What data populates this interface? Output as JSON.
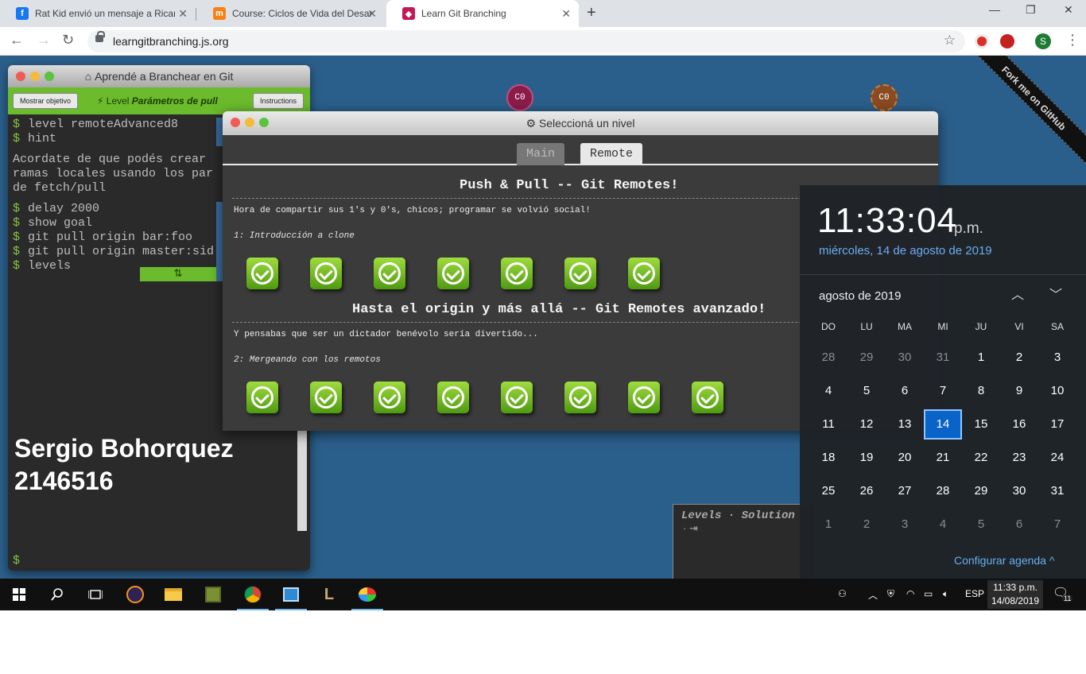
{
  "browser": {
    "tabs": [
      {
        "title": "Rat Kid envió un mensaje a Ricar",
        "fav": "f",
        "fav_color": "#1877f2",
        "close": "✕"
      },
      {
        "title": "Course: Ciclos de Vida del Desarr",
        "fav": "m",
        "fav_color": "#f98012",
        "close": "✕"
      },
      {
        "title": "Learn Git Branching",
        "fav": "◆",
        "fav_color": "#c2185b",
        "close": "✕"
      }
    ],
    "new_tab": "+",
    "window": {
      "minimize": "—",
      "maximize": "❐",
      "close": "✕"
    },
    "nav": {
      "back": "←",
      "forward": "→",
      "reload": "↻"
    },
    "url": "learngitbranching.js.org",
    "star": "☆",
    "profile_initial": "S",
    "menu": "⋮"
  },
  "page": {
    "nodes": [
      {
        "label": "C0",
        "color": "#8b1c4a"
      },
      {
        "label": "C0",
        "color": "#8a4a22"
      }
    ],
    "fork_ribbon": "Fork me on GitHub",
    "terminal": {
      "title": "Aprendé a Branchear en Git",
      "show_goal": "Mostrar objetivo",
      "level_prefix": "Level",
      "level_name": "Parámetros de pull",
      "instructions": "Instructions",
      "lines_a": [
        "level remoteAdvanced8",
        "hint"
      ],
      "hint_text": [
        "Acordate de que podés crear",
        "ramas locales usando los par",
        "de fetch/pull"
      ],
      "lines_b": [
        "delay 2000",
        "show goal",
        "git pull origin bar:foo",
        "git pull origin master:sid",
        "levels"
      ],
      "levels_icon": "⇅",
      "dollar": "$",
      "signature_name": "Sergio Bohorquez",
      "signature_id": "2146516"
    },
    "dialog": {
      "title": "Seleccioná un nivel",
      "gear": "⚙",
      "tabs": [
        "Main",
        "Remote"
      ],
      "sections": [
        {
          "title": "Push & Pull -- Git Remotes!",
          "desc": "Hora de compartir sus 1's y 0's, chicos; programar se volvió social!",
          "sub": "1: Introducción a clone",
          "count": 7
        },
        {
          "title": "Hasta el origin y más allá -- Git Remotes avanzado!",
          "desc": "Y pensabas que ser un dictador benévolo sería divertido...",
          "sub": "2: Mergeando con los remotos",
          "count": 8
        }
      ]
    },
    "mini_panel": {
      "title": "Levels · Solution",
      "sub": "· ⇥"
    }
  },
  "calendar": {
    "time": "11:33:04",
    "ampm": "p.m.",
    "date": "miércoles, 14 de agosto de 2019",
    "month": "agosto de 2019",
    "up": "︿",
    "down": "﹀",
    "weekdays": [
      "DO",
      "LU",
      "MA",
      "MI",
      "JU",
      "VI",
      "SA"
    ],
    "days": [
      [
        "28",
        "29",
        "30",
        "31",
        "1",
        "2",
        "3"
      ],
      [
        "4",
        "5",
        "6",
        "7",
        "8",
        "9",
        "10"
      ],
      [
        "11",
        "12",
        "13",
        "14",
        "15",
        "16",
        "17"
      ],
      [
        "18",
        "19",
        "20",
        "21",
        "22",
        "23",
        "24"
      ],
      [
        "25",
        "26",
        "27",
        "28",
        "29",
        "30",
        "31"
      ],
      [
        "1",
        "2",
        "3",
        "4",
        "5",
        "6",
        "7"
      ]
    ],
    "today": "14",
    "configure": "Configurar agenda ^"
  },
  "taskbar": {
    "language": "ESP",
    "clock_time": "11:33 p.m.",
    "clock_date": "14/08/2019",
    "notifications": "11"
  }
}
